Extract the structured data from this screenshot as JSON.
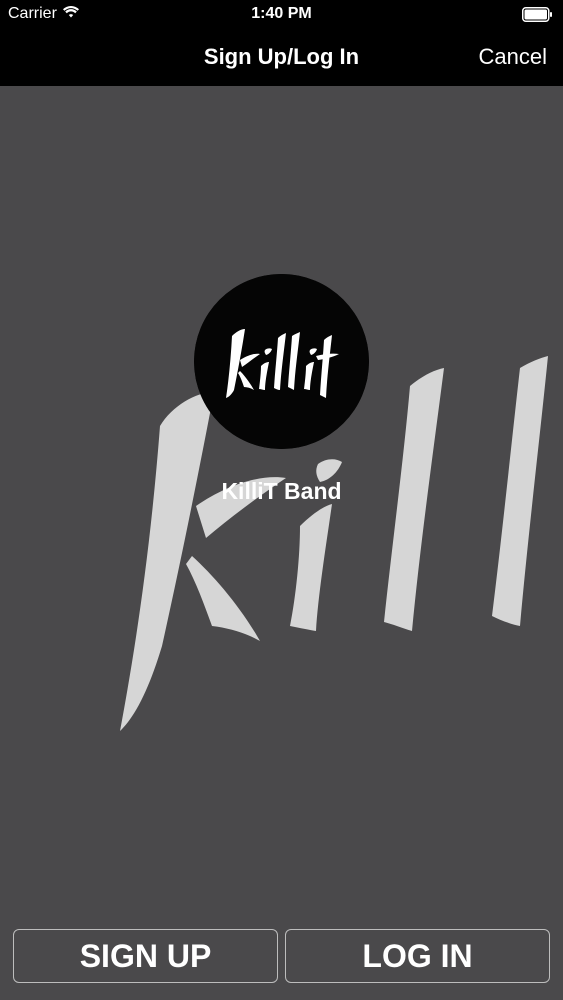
{
  "status_bar": {
    "carrier": "Carrier",
    "time": "1:40 PM",
    "wifi_icon": "wifi-icon",
    "battery_icon": "battery-icon",
    "battery_level": 1.0
  },
  "nav": {
    "title": "Sign Up/Log In",
    "cancel_label": "Cancel"
  },
  "profile": {
    "band_name": "KilliT Band",
    "logo_text": "killit"
  },
  "buttons": {
    "signup_label": "SIGN UP",
    "login_label": "LOG IN"
  },
  "colors": {
    "background": "#4a494b",
    "bar": "#000000",
    "text": "#ffffff",
    "watermark": "#d6d6d6"
  }
}
